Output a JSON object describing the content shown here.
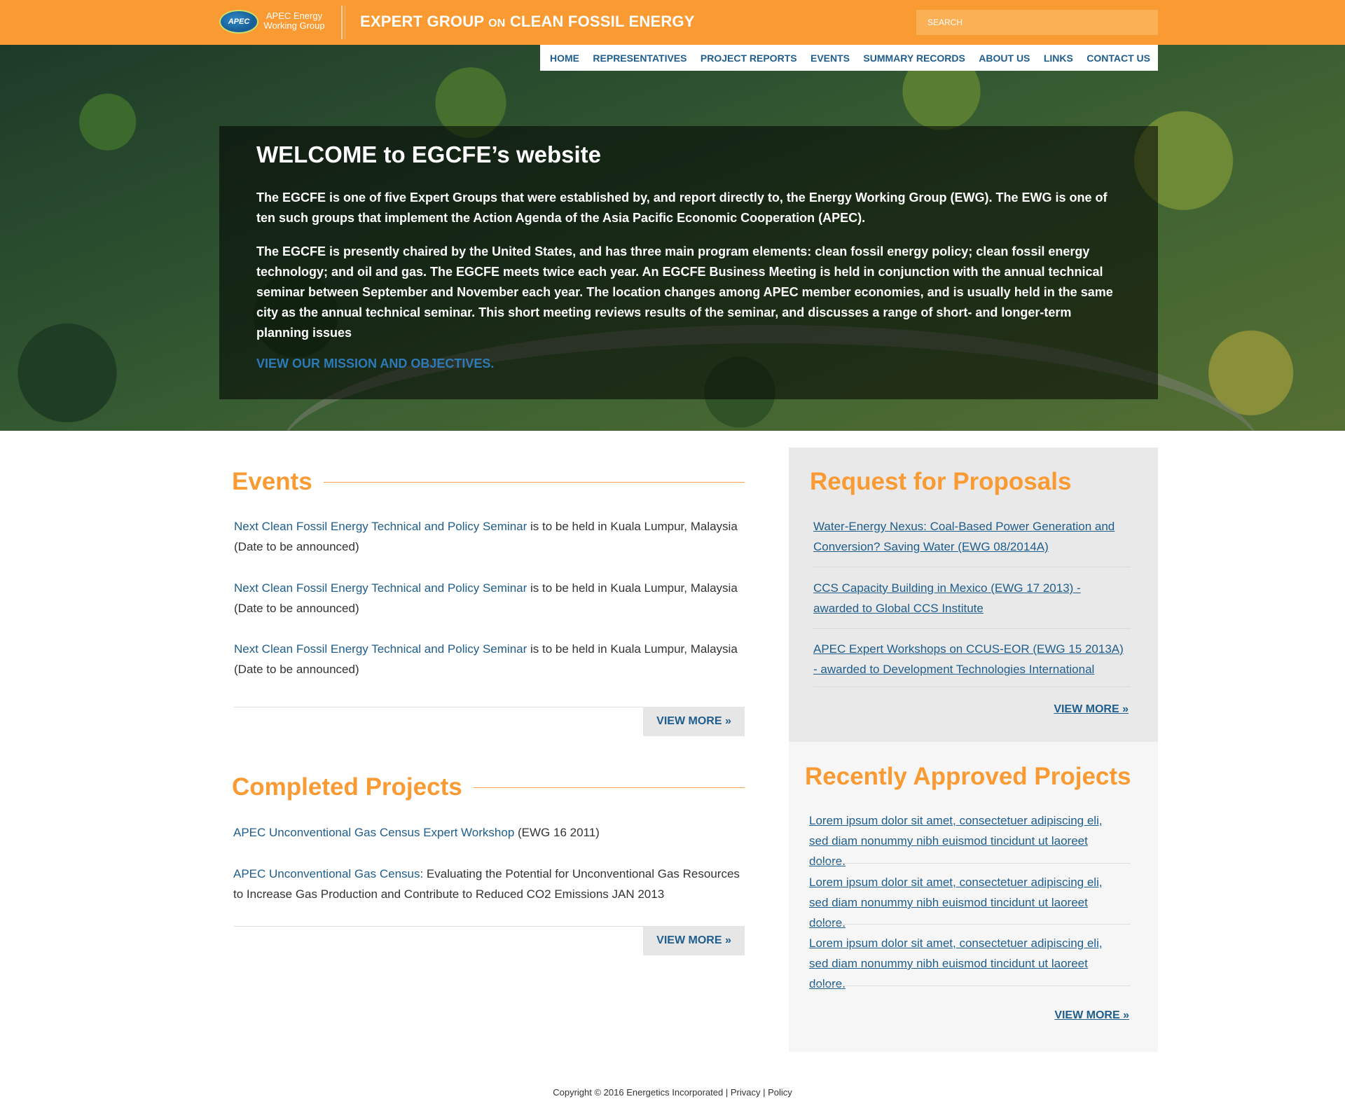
{
  "header": {
    "logo_badge": "APEC",
    "logo_text": "APEC Energy Working Group",
    "title_part1": "EXPERT GROUP",
    "title_on": "ON",
    "title_part2": "CLEAN FOSSIL ENERGY",
    "search_placeholder": "SEARCH"
  },
  "nav": [
    {
      "label": "HOME"
    },
    {
      "label": "REPRESENTATIVES"
    },
    {
      "label": "PROJECT REPORTS"
    },
    {
      "label": "EVENTS"
    },
    {
      "label": "SUMMARY RECORDS"
    },
    {
      "label": "ABOUT US"
    },
    {
      "label": "LINKS"
    },
    {
      "label": "CONTACT US"
    }
  ],
  "hero": {
    "heading": "WELCOME to EGCFE’s website",
    "paragraph1": "The EGCFE is one of five Expert Groups that were established by, and report directly to, the Energy Working Group (EWG). The EWG is one of ten such groups that implement the Action Agenda of the Asia Pacific Economic Cooperation (APEC).",
    "paragraph2": "The EGCFE is presently chaired by the United States, and has three main program elements: clean fossil energy policy; clean fossil energy technology; and oil and gas. The EGCFE meets twice each year. An EGCFE Business Meeting is held in conjunction with the annual technical seminar between September and November each year. The location changes among APEC member economies, and is usually held in the same city as the annual technical seminar. This short meeting reviews results of the seminar, and discusses a range of short- and longer-term planning issues",
    "mission_link": "VIEW OUR MISSION AND OBJECTIVES."
  },
  "events": {
    "heading": "Events",
    "items": [
      {
        "link": "Next Clean Fossil Energy Technical and Policy Seminar",
        "text": " is to be held in Kuala Lumpur, Malaysia (Date to be announced)"
      },
      {
        "link": "Next Clean Fossil Energy Technical and Policy Seminar",
        "text": " is to be held in Kuala Lumpur, Malaysia (Date to be announced)"
      },
      {
        "link": "Next Clean Fossil Energy Technical and Policy Seminar",
        "text": " is to be held in Kuala Lumpur, Malaysia (Date to be announced)"
      }
    ],
    "view_more": "VIEW MORE »"
  },
  "completed": {
    "heading": "Completed Projects",
    "items": [
      {
        "link": "APEC Unconventional Gas Census Expert Workshop",
        "text": " (EWG 16 2011)"
      },
      {
        "link": "APEC Unconventional Gas Census",
        "text": ": Evaluating the Potential for Unconventional Gas Resources to Increase Gas Production and Contribute to Reduced CO2 Emissions JAN 2013"
      }
    ],
    "view_more": "VIEW MORE »"
  },
  "rfp": {
    "heading": "Request for Proposals",
    "items": [
      {
        "label": "Water-Energy Nexus: Coal-Based Power Generation and Conversion? Saving Water (EWG 08/2014A)"
      },
      {
        "label": "CCS Capacity Building in Mexico (EWG 17 2013) - awarded to Global CCS Institute"
      },
      {
        "label": "APEC Expert Workshops on CCUS-EOR (EWG 15 2013A) - awarded to Development Technologies International"
      }
    ],
    "view_more": "VIEW MORE »"
  },
  "approved": {
    "heading": "Recently Approved Projects",
    "items": [
      {
        "label": "Lorem ipsum dolor sit amet, consectetuer adipiscing eli, sed diam nonummy nibh euismod tincidunt ut laoreet dolore."
      },
      {
        "label": "Lorem ipsum dolor sit amet, consectetuer adipiscing eli, sed diam nonummy nibh euismod tincidunt ut laoreet dolore."
      },
      {
        "label": "Lorem ipsum dolor sit amet, consectetuer adipiscing eli, sed diam nonummy nibh euismod tincidunt ut laoreet dolore."
      }
    ],
    "view_more": "VIEW MORE »"
  },
  "footer": {
    "copyright": "Copyright © 2016 Energetics Incorporated",
    "sep": " | ",
    "privacy": "Privacy",
    "policy": "Policy"
  },
  "colors": {
    "brand_orange": "#fa9a33",
    "link_blue": "#1f5d8c"
  }
}
